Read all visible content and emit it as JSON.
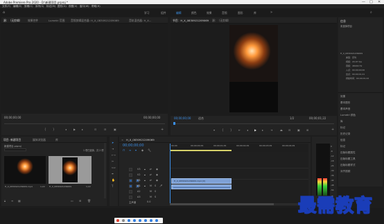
{
  "titlebar": {
    "title": "Adobe Premiere Pro 2020 - D:\\新建项目.prproj *",
    "min": "—",
    "max": "□",
    "close": "✕"
  },
  "menu": [
    "文件(F)",
    "编辑(E)",
    "剪辑(C)",
    "序列(S)",
    "标记(M)",
    "图形(G)",
    "视图(V)",
    "窗口(W)",
    "帮助(H)"
  ],
  "workspaces": [
    "学习",
    "组件",
    "编辑",
    "颜色",
    "效果",
    "音频",
    "图形",
    "库"
  ],
  "workspace_active": "编辑",
  "source": {
    "tabs": [
      "源：（无剪辑）",
      "效果控件",
      "Lumetri 范围",
      "音频剪辑混合器: H_X_0830921209069",
      "音轨混合器: H_X..."
    ],
    "timecode_left": "00;00;00;00",
    "timecode_right": "00;00;00;00"
  },
  "program": {
    "tabs": [
      "节目：H_X_0830921209069",
      "源：（无剪辑）"
    ],
    "timecode_left": "00;00;00;00",
    "fit": "适合",
    "quality": "1/2",
    "timecode_right": "00;00;01;22"
  },
  "project": {
    "tabs": [
      "项目: 新建项目",
      "媒体浏览器",
      "库"
    ],
    "path": "新建项目.prproj",
    "items_info": "1 项已选择，共 2 项",
    "items": [
      {
        "name": "H_X_0830921209069.mp4",
        "dur": "1;22"
      },
      {
        "name": "H_X_0830921209069",
        "dur": "1;22"
      }
    ]
  },
  "timeline": {
    "tab": "H_X_0830921209069",
    "timecode": "00;00;00;00",
    "ruler": [
      "00;00",
      "00;00;00;29",
      "00;00;01;29",
      "00;00;02;29",
      "00;00;03;29",
      "00;00;04;29"
    ],
    "video_tracks": [
      "V3",
      "V2",
      "V1"
    ],
    "audio_tracks": [
      "A1",
      "A2",
      "A3"
    ],
    "master": "主声道",
    "master_val": "0.0",
    "clip_label": "H_X_0830921209069.mp4 [V]"
  },
  "effects_panel": {
    "header": "信息",
    "section": "未选择项目",
    "fields": [
      "H_X_0830921209069",
      "类型：序列",
      "视频：29.97 fps",
      "音频：48000 Hz",
      "入点：00;00;00;00",
      "出点：00;00;01;21",
      "持续时间：00;00;01;22"
    ],
    "items": [
      "效果",
      "基本图形",
      "基本声音",
      "Lumetri 颜色",
      "库",
      "标记",
      "历史记录",
      "信息",
      "标记",
      "旧版标题属性",
      "旧版标题工具",
      "旧版标题样式",
      "对齐视频"
    ]
  },
  "meter_labels": [
    "0",
    "-6",
    "-12",
    "-18",
    "-24",
    "-30",
    "-36",
    "-42",
    "-48",
    "-54",
    "dB"
  ],
  "watermark": "最需教育",
  "colors": {
    "accent": "#3b8ee6",
    "clip": "#7ea1d6",
    "bg": "#232323"
  }
}
